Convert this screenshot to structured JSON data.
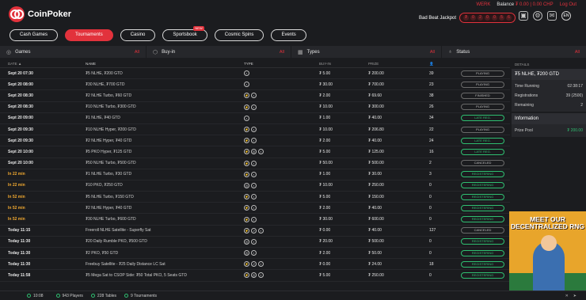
{
  "header": {
    "logo_text": "CoinPoker",
    "username": "WERK",
    "balance_label": "Balance",
    "balance_value": "₮ 0.00 | 0.00 CHP",
    "logout_label": "Log Out",
    "jackpot_label": "Bad Beat Jackpot",
    "jackpot_digits": [
      "₮",
      "0",
      "2",
      "0",
      "0",
      "5",
      "6"
    ],
    "lang": "EN"
  },
  "nav": {
    "tabs": [
      {
        "label": "Cash Games",
        "active": false
      },
      {
        "label": "Tournaments",
        "active": true
      },
      {
        "label": "Casino",
        "active": false
      },
      {
        "label": "Sportsbook",
        "active": false,
        "badge": "NEW"
      },
      {
        "label": "Cosmic Spins",
        "active": false
      },
      {
        "label": "Events",
        "active": false
      }
    ]
  },
  "filters": {
    "games": {
      "label": "Games",
      "value": "All"
    },
    "buyin": {
      "label": "Buy-in",
      "value": "All"
    },
    "types": {
      "label": "Types",
      "value": "All"
    },
    "status": {
      "label": "Status",
      "value": "All"
    }
  },
  "table": {
    "headers": {
      "date": "DATE ▲",
      "name": "NAME",
      "type": "TYPE",
      "buyin": "BUY-IN",
      "prize": "PRIZE",
      "players_icon": "person-icon"
    },
    "rows": [
      {
        "date": "Sept 20 07:30",
        "name": "₮5 NLHE, ₮200 GTD",
        "types": [
          "S"
        ],
        "buyin": "₮ 5.00",
        "prize": "₮ 200.00",
        "players": "39",
        "status": "PLAYING",
        "color": "grey",
        "orange": false
      },
      {
        "date": "Sept 20 08:00",
        "name": "₮30 NLHE, ₮700 GTD",
        "types": [
          "S"
        ],
        "buyin": "₮ 30.00",
        "prize": "₮ 700.00",
        "players": "23",
        "status": "PLAYING",
        "color": "grey",
        "orange": false
      },
      {
        "date": "Sept 20 08:30",
        "name": "₮2 NLHE Turbo, ₮60 GTD",
        "types": [
          "T",
          "S"
        ],
        "buyin": "₮ 2.00",
        "prize": "₮ 69.60",
        "players": "38",
        "status": "FINISHED",
        "color": "grey",
        "orange": false
      },
      {
        "date": "Sept 20 08:30",
        "name": "₮10 NLHE Turbo, ₮300 GTD",
        "types": [
          "T",
          "S"
        ],
        "buyin": "₮ 10.00",
        "prize": "₮ 300.00",
        "players": "26",
        "status": "PLAYING",
        "color": "grey",
        "orange": false
      },
      {
        "date": "Sept 20 09:00",
        "name": "₮1 NLHE, ₮40 GTD",
        "types": [
          "S"
        ],
        "buyin": "₮ 1.00",
        "prize": "₮ 40.00",
        "players": "34",
        "status": "LATE REG.",
        "color": "green",
        "orange": false
      },
      {
        "date": "Sept 20 09:30",
        "name": "₮10 NLHE Hyper, ₮200 GTD",
        "types": [
          "T",
          "S"
        ],
        "buyin": "₮ 10.00",
        "prize": "₮ 206.80",
        "players": "22",
        "status": "PLAYING",
        "color": "grey",
        "orange": false
      },
      {
        "date": "Sept 20 09:30",
        "name": "₮2 NLHE Hyper, ₮40 GTD",
        "types": [
          "T",
          "S"
        ],
        "buyin": "₮ 2.00",
        "prize": "₮ 40.00",
        "players": "24",
        "status": "LATE REG.",
        "color": "green",
        "orange": false
      },
      {
        "date": "Sept 20 10:00",
        "name": "₮5 PKO Hyper, ₮125 GTD",
        "types": [
          "T",
          "K",
          "S"
        ],
        "buyin": "₮ 5.00",
        "prize": "₮ 125.00",
        "players": "16",
        "status": "LATE REG.",
        "color": "green",
        "orange": false
      },
      {
        "date": "Sept 20 10:00",
        "name": "₮50 NLHE Turbo, ₮500 GTD",
        "types": [
          "T",
          "S"
        ],
        "buyin": "₮ 50.00",
        "prize": "₮ 500.00",
        "players": "2",
        "status": "CANCELED",
        "color": "grey",
        "orange": false
      },
      {
        "date": "In 22 min",
        "name": "₮1 NLHE Turbo, ₮30 GTD",
        "types": [
          "T",
          "S"
        ],
        "buyin": "₮ 1.00",
        "prize": "₮ 30.00",
        "players": "3",
        "status": "REGISTERING",
        "color": "green",
        "orange": true
      },
      {
        "date": "In 22 min",
        "name": "₮10 PKO, ₮250 GTD",
        "types": [
          "K",
          "S"
        ],
        "buyin": "₮ 10.00",
        "prize": "₮ 250.00",
        "players": "0",
        "status": "REGISTERING",
        "color": "green",
        "orange": true
      },
      {
        "date": "In 52 min",
        "name": "₮5 NLHE Turbo, ₮150 GTD",
        "types": [
          "T",
          "S"
        ],
        "buyin": "₮ 5.00",
        "prize": "₮ 150.00",
        "players": "0",
        "status": "REGISTERING",
        "color": "green",
        "orange": true
      },
      {
        "date": "In 52 min",
        "name": "₮2 NLHE Hyper, ₮40 GTD",
        "types": [
          "T",
          "S"
        ],
        "buyin": "₮ 2.00",
        "prize": "₮ 40.00",
        "players": "0",
        "status": "REGISTERING",
        "color": "green",
        "orange": true
      },
      {
        "date": "In 52 min",
        "name": "₮30 NLHE Turbo, ₮600 GTD",
        "types": [
          "T",
          "S"
        ],
        "buyin": "₮ 30.00",
        "prize": "₮ 600.00",
        "players": "0",
        "status": "REGISTERING",
        "color": "green",
        "orange": true
      },
      {
        "date": "Today 11:15",
        "name": "Freeroll NLHE Satellite - Superfly Sat",
        "types": [
          "T",
          "R",
          "S"
        ],
        "buyin": "₮ 0.00",
        "prize": "₮ 40.00",
        "players": "127",
        "status": "CANCELED",
        "color": "grey",
        "orange": false
      },
      {
        "date": "Today 11:30",
        "name": "₮20 Daily Rumble PKO, ₮500 GTD",
        "types": [
          "K",
          "S"
        ],
        "buyin": "₮ 20.00",
        "prize": "₮ 500.00",
        "players": "0",
        "status": "REGISTERING",
        "color": "green",
        "orange": false
      },
      {
        "date": "Today 11:30",
        "name": "₮2 PKO, ₮50 GTD",
        "types": [
          "K",
          "S"
        ],
        "buyin": "₮ 2.00",
        "prize": "₮ 50.00",
        "players": "0",
        "status": "REGISTERING",
        "color": "green",
        "orange": false
      },
      {
        "date": "Today 11:30",
        "name": "Freebuy Satellite - ₮25 Daily Distance LC Sat",
        "types": [
          "T",
          "R",
          "S"
        ],
        "buyin": "₮ 0.00",
        "prize": "₮ 24.00",
        "players": "18",
        "status": "REGISTERING",
        "color": "green",
        "orange": false
      },
      {
        "date": "Today 11:58",
        "name": "₮5 Mega Sat to CSOP Side: ₮50 Total PKO, 5 Seats GTD",
        "types": [
          "T",
          "K",
          "S"
        ],
        "buyin": "₮ 5.00",
        "prize": "₮ 250.00",
        "players": "0",
        "status": "REGISTERING",
        "color": "green",
        "orange": false
      }
    ]
  },
  "details": {
    "header": "DETAILS",
    "title": "₮5 NLHE, ₮200 GTD",
    "rows": [
      {
        "label": "Time Running",
        "value": "02:38:17"
      },
      {
        "label": "Registrations",
        "value": "39 (2500)"
      },
      {
        "label": "Remaining",
        "value": "2"
      }
    ],
    "info_label": "Information",
    "prize_pool_label": "Prize Pool",
    "prize_pool_value": "₮ 200.00"
  },
  "promo": {
    "text": "MEET OUR DECENTRALIZED RNG"
  },
  "footer": {
    "time": "10:08",
    "players": "943 Players",
    "tables": "228 Tables",
    "tournaments": "9 Tournaments"
  },
  "colors": {
    "accent": "#e2323c",
    "green": "#2fbf71",
    "orange": "#f0a830"
  }
}
